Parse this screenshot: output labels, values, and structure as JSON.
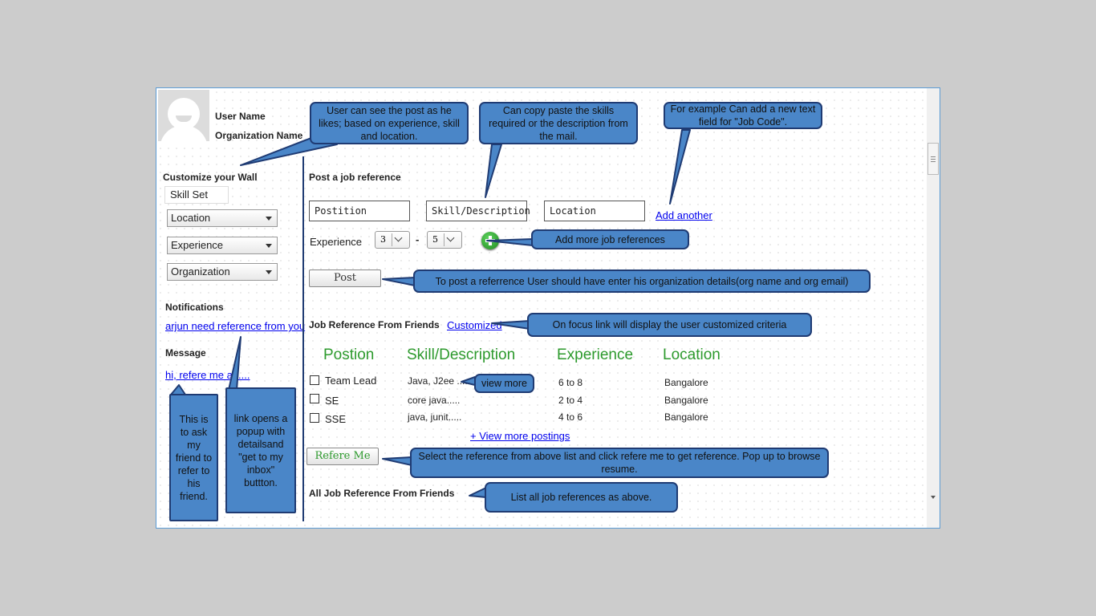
{
  "profile": {
    "user_name": "User Name",
    "organization_name": "Organization Name"
  },
  "sidebar": {
    "customize_title": "Customize your Wall",
    "skill_set": "Skill Set",
    "location": "Location",
    "experience": "Experience",
    "organization": "Organization",
    "notifications_title": "Notifications",
    "notification_link": "arjun need reference from you",
    "message_title": "Message",
    "message_link": "hi, refere me a ....."
  },
  "post_form": {
    "title": "Post a job reference",
    "position_placeholder": "Postition",
    "skill_placeholder": "Skill/Description",
    "location_placeholder": "Location",
    "add_another": "Add another",
    "experience_label": "Experience",
    "exp_min": "3",
    "exp_dash": "-",
    "exp_max": "5",
    "post_button": "Post"
  },
  "friends_refs": {
    "title": "Job Reference From Friends",
    "customized_link": "Customized",
    "headers": [
      "Postion",
      "Skill/Description",
      "Experience",
      "Location"
    ],
    "rows": [
      {
        "position": "Team Lead",
        "skill": "Java, J2ee .....",
        "experience": "6 to 8",
        "location": "Bangalore"
      },
      {
        "position": "SE",
        "skill": "core java.....",
        "experience": "2 to 4",
        "location": "Bangalore"
      },
      {
        "position": "SSE",
        "skill": "java, junit.....",
        "experience": "4 to 6",
        "location": "Bangalore"
      }
    ],
    "view_more_postings": "+ View more postings",
    "refere_button": "Refere Me",
    "all_title": "All Job Reference From Friends"
  },
  "callouts": {
    "wall": "User can see the post as he likes; based on experience, skill and location.",
    "copy": "Can copy paste the skills required or the description from the mail.",
    "example": "For example Can add a new text field for \"Job Code\".",
    "add_more": "Add more job references",
    "post_note": "To post a referrence User should have enter his organization details(org name and org email)",
    "focus": "On focus link will display the user customized criteria",
    "view_more": "view more",
    "select": "Select the reference from above list and click refere me to get reference. Pop up to browse resume.",
    "list_all": "List all job references as above.",
    "ask_friend": "This is to ask my friend to refer to his friend.",
    "popup": "link opens a popup with detailsand \"get to my inbox\" buttton."
  },
  "colors": {
    "callout_fill": "#4a86c8",
    "callout_border": "#1f3b73",
    "header_green": "#2d9a2d",
    "link_blue": "#0000ee"
  }
}
